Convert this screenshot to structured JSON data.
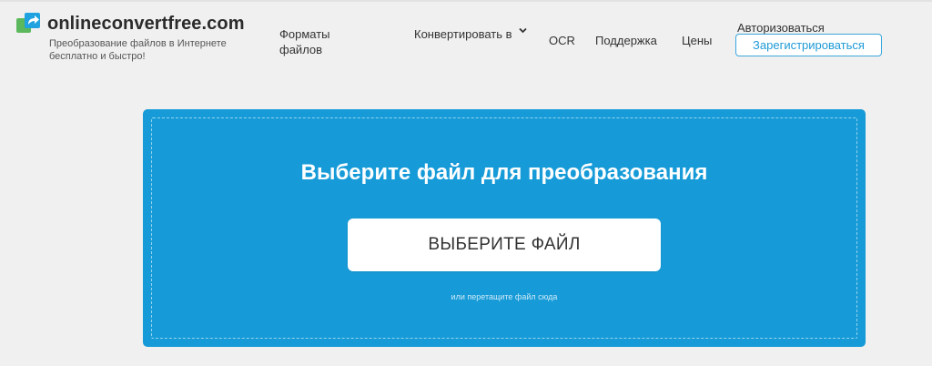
{
  "header": {
    "logo_text": "onlineconvertfree.com",
    "tagline": "Преобразование файлов в Интернете бесплатно и быстро!",
    "nav": {
      "formats": "Форматы файлов",
      "convert": "Конвертировать в",
      "ocr": "OCR",
      "support": "Поддержка",
      "prices": "Цены",
      "login": "Авторизоваться",
      "signup": "Зарегистрироваться"
    }
  },
  "upload": {
    "title": "Выберите файл для преобразования",
    "button": "ВЫБЕРИТЕ ФАЙЛ",
    "hint": "или перетащите файл сюда"
  },
  "colors": {
    "accent": "#169bd8",
    "logo_green": "#5cb85c",
    "logo_blue": "#1fa3e0"
  }
}
